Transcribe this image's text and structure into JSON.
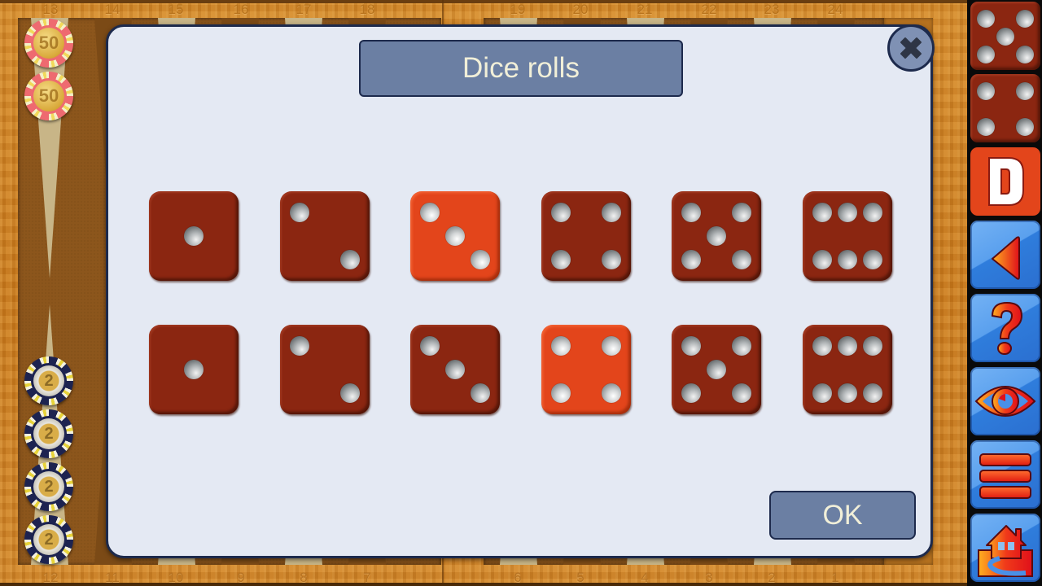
{
  "board": {
    "top_point_numbers": [
      "13",
      "14",
      "15",
      "16",
      "17",
      "18",
      "19",
      "20",
      "21",
      "22",
      "23",
      "24"
    ],
    "bottom_point_numbers": [
      "12",
      "11",
      "10",
      "9",
      "8",
      "7",
      "6",
      "5",
      "4",
      "3",
      "2",
      "1"
    ],
    "left_stack_top": {
      "chip_type": "red-50-cent",
      "label": "50",
      "count": 2
    },
    "left_stack_bottom": {
      "chip_type": "navy-2-euro",
      "label": "2",
      "count": 4
    }
  },
  "dialog": {
    "title": "Dice rolls",
    "close_icon": "close-x-icon",
    "ok_label": "OK",
    "rows": [
      {
        "dice": [
          {
            "value": 1,
            "selected": false
          },
          {
            "value": 2,
            "selected": false
          },
          {
            "value": 3,
            "selected": true
          },
          {
            "value": 4,
            "selected": false
          },
          {
            "value": 5,
            "selected": false
          },
          {
            "value": 6,
            "selected": false
          }
        ]
      },
      {
        "dice": [
          {
            "value": 1,
            "selected": false
          },
          {
            "value": 2,
            "selected": false
          },
          {
            "value": 3,
            "selected": false
          },
          {
            "value": 4,
            "selected": true
          },
          {
            "value": 5,
            "selected": false
          },
          {
            "value": 6,
            "selected": false
          }
        ]
      }
    ],
    "colors": {
      "die": "#8b2611",
      "die_selected": "#e3451b",
      "panel": "#e4e9f3",
      "button": "#6b7fa3",
      "border": "#1d2a4c"
    }
  },
  "sidebar": {
    "current_dice": [
      5,
      4
    ],
    "buttons": [
      {
        "id": "die-1",
        "icon": "die-face-icon",
        "value": 5
      },
      {
        "id": "die-2",
        "icon": "die-face-icon",
        "value": 4
      },
      {
        "id": "double",
        "icon": "doubling-cube-icon",
        "label": "D"
      },
      {
        "id": "undo",
        "icon": "back-arrow-icon"
      },
      {
        "id": "help",
        "icon": "question-mark-icon",
        "label": "?"
      },
      {
        "id": "hint",
        "icon": "eye-icon"
      },
      {
        "id": "menu",
        "icon": "hamburger-menu-icon"
      },
      {
        "id": "home",
        "icon": "home-icon"
      }
    ]
  }
}
